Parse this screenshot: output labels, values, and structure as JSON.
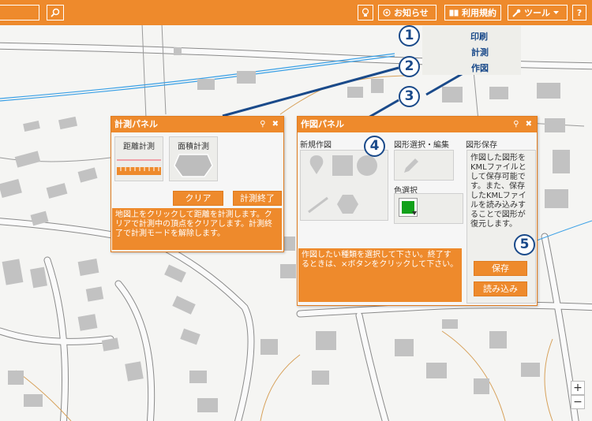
{
  "toolbar": {
    "search_value": "",
    "menu_buttons": [
      {
        "label": "",
        "icon": "bulb-icon"
      },
      {
        "label": "お知らせ",
        "icon": "notice-icon"
      },
      {
        "label": "利用規約",
        "icon": "book-icon"
      },
      {
        "label": "ツール",
        "icon": "wrench-icon"
      },
      {
        "label": "?",
        "icon": "help-icon"
      }
    ]
  },
  "tool_menu": {
    "items": [
      "印刷",
      "計測",
      "作図"
    ]
  },
  "callouts": [
    "1",
    "2",
    "3",
    "4",
    "5"
  ],
  "measure_panel": {
    "title": "計測パネル",
    "tools": [
      "距離計測",
      "面積計測"
    ],
    "clear_label": "クリア",
    "end_label": "計測終了",
    "info": "地図上をクリックして距離を計測します。クリアで計測中の頂点をクリアします。計測終了で計測モードを解除します。"
  },
  "draw_panel": {
    "title": "作図パネル",
    "section_new": "新規作図",
    "section_edit": "図形選択・編集",
    "section_save": "図形保存",
    "color_label": "色選択",
    "selected_color": "#11a11a",
    "save_info": "作図した図形をKMLファイルとして保存可能です。また、保存したKMLファイルを読み込みすることで図形が復元します。",
    "info": "作図したい種類を選択して下さい。終了するときは、×ボタンをクリックして下さい。",
    "save_label": "保存",
    "load_label": "読み込み"
  },
  "zoom": {
    "plus": "+",
    "minus": "−"
  },
  "colors": {
    "accent": "#ee8a2c",
    "callout": "#1a4a8a"
  }
}
